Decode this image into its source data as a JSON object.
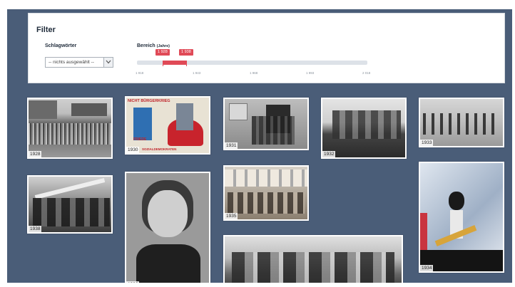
{
  "filter": {
    "title": "Filter",
    "keywords_label": "Schlagwörter",
    "keywords_select": "-- nichts ausgewählt --",
    "range_label": "Bereich",
    "range_unit": "(Jahre)",
    "range_low_value": "1 928",
    "range_high_value": "1 938",
    "range_min": 1918,
    "range_max": 2018,
    "axis_ticks": [
      "1 918",
      "1 943",
      "1 968",
      "1 993",
      "2 018"
    ]
  },
  "photos": [
    {
      "year": "1928"
    },
    {
      "year": "1930",
      "poster_text_1": "NICHT BÜRGERKRIEG",
      "poster_text_2": "FRIEDE",
      "poster_text_3": "SOZIALDEMOKRATEN"
    },
    {
      "year": "1931"
    },
    {
      "year": "1932"
    },
    {
      "year": "1933"
    },
    {
      "year": "1938"
    },
    {
      "year": "1936"
    },
    {
      "year": "1935"
    },
    {
      "year": ""
    },
    {
      "year": "1934"
    }
  ],
  "colors": {
    "background": "#4a5d78",
    "accent": "#e04a57"
  }
}
